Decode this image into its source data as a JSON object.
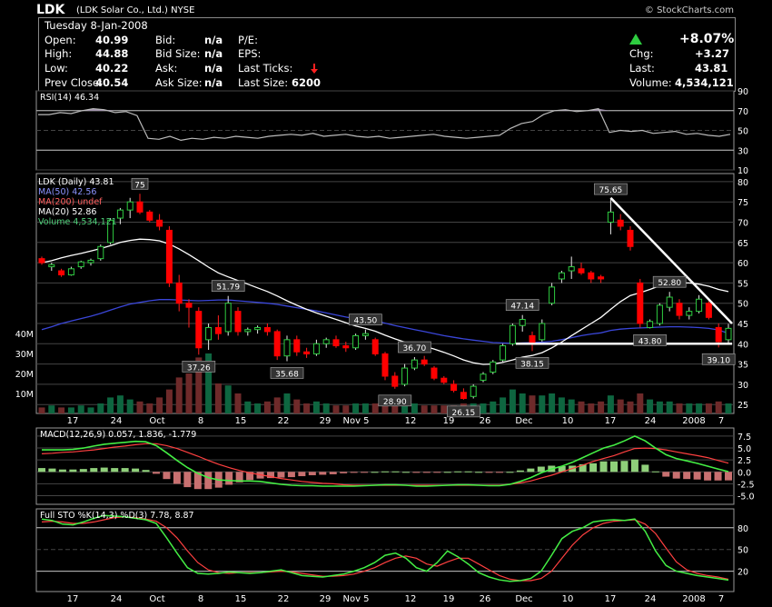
{
  "header": {
    "symbol": "LDK",
    "name": "(LDK Solar Co., Ltd.)",
    "exchange": "NYSE",
    "watermark": "© StockCharts.com",
    "date": "Tuesday  8-Jan-2008",
    "open_label": "Open:",
    "open": "40.99",
    "high_label": "High:",
    "high": "44.88",
    "low_label": "Low:",
    "low": "40.22",
    "prev_label": "Prev Close:",
    "prev": "40.54",
    "bid_label": "Bid:",
    "bid": "n/a",
    "bidsize_label": "Bid Size:",
    "bidsize": "n/a",
    "ask_label": "Ask:",
    "ask": "n/a",
    "asksize_label": "Ask Size:",
    "asksize": "n/a",
    "pe_label": "P/E:",
    "eps_label": "EPS:",
    "lastticks_label": "Last Ticks:",
    "lastsize_label": "Last Size:",
    "lastsize": "6200",
    "pct_change": "+8.07%",
    "chg_label": "Chg:",
    "chg": "+3.27",
    "last_label": "Last:",
    "last": "43.81",
    "volume_label": "Volume:",
    "volume": "4,534,121"
  },
  "colors": {
    "up": "#2ecc40",
    "down": "#ff0000",
    "ma50": "#3a46d8",
    "ma20": "#ffffff",
    "vol_up": "#0e6640",
    "vol_down": "#6e2a2a",
    "grid": "#444"
  },
  "chart_data": [
    {
      "type": "line",
      "title": "RSI(14) 46.34",
      "ylim": [
        10,
        90
      ],
      "y_ticks": [
        "90",
        "70",
        "50",
        "30",
        "10"
      ],
      "series": [
        {
          "name": "RSI(14)",
          "values": [
            66,
            66,
            68,
            67,
            70,
            72,
            71,
            68,
            69,
            65,
            42,
            41,
            44,
            40,
            42,
            41,
            43,
            42,
            44,
            43,
            42,
            44,
            45,
            46,
            45,
            47,
            44,
            45,
            46,
            44,
            43,
            44,
            42,
            43,
            44,
            45,
            46,
            44,
            43,
            42,
            43,
            44,
            45,
            52,
            57,
            59,
            66,
            70,
            71,
            69,
            70,
            72,
            48,
            50,
            49,
            50,
            47,
            48,
            49,
            46,
            47,
            45,
            44,
            46
          ]
        }
      ]
    },
    {
      "type": "candlestick",
      "legend": [
        "LDK (Daily) 43.81",
        "MA(50) 42.56",
        "MA(200) undef",
        "MA(20) 52.86",
        "Volume 4,534,121"
      ],
      "ylim": [
        25,
        80
      ],
      "y_ticks": [
        "80",
        "75",
        "70",
        "65",
        "60",
        "55",
        "50",
        "45",
        "40",
        "35",
        "30",
        "25"
      ],
      "x_ticks": [
        "17",
        "24",
        "Oct",
        "8",
        "15",
        "22",
        "29",
        "Nov 5",
        "12",
        "19",
        "26",
        "Dec",
        "10",
        "17",
        "24",
        "2008",
        "7"
      ],
      "volume_ticks": [
        "40M",
        "30M",
        "20M",
        "10M"
      ],
      "annotations": [
        "75",
        "51.79",
        "37.26",
        "35.68",
        "43.50",
        "36.70",
        "28.90",
        "26.15",
        "47.14",
        "38.15",
        "75.65",
        "52.80",
        "43.80",
        "39.10"
      ],
      "ohlc": [
        [
          61,
          61.5,
          59.5,
          60.0
        ],
        [
          59,
          60,
          58,
          59.5
        ],
        [
          58,
          58.5,
          56.5,
          57
        ],
        [
          57,
          59,
          56.8,
          58.5
        ],
        [
          59,
          60.5,
          58.5,
          60.2
        ],
        [
          60,
          61,
          59.3,
          60.6
        ],
        [
          61,
          64.5,
          60.5,
          64
        ],
        [
          65,
          71,
          64.5,
          70.5
        ],
        [
          71,
          73.5,
          69.5,
          73
        ],
        [
          73,
          76,
          71,
          75
        ],
        [
          75,
          77,
          72,
          72.5
        ],
        [
          72.5,
          73,
          70,
          70.5
        ],
        [
          70.5,
          72,
          68,
          69
        ],
        [
          68,
          69,
          54,
          55
        ],
        [
          55,
          57,
          48,
          50
        ],
        [
          50,
          51,
          44,
          49
        ],
        [
          48,
          49,
          37.3,
          39
        ],
        [
          41,
          45,
          38.5,
          44
        ],
        [
          44,
          47,
          41,
          42.5
        ],
        [
          43,
          51.8,
          42,
          50
        ],
        [
          48,
          49,
          42,
          43
        ],
        [
          43,
          44,
          42,
          43.5
        ],
        [
          43.5,
          44.5,
          42.5,
          44
        ],
        [
          44,
          45,
          42,
          43
        ],
        [
          43,
          43.5,
          36,
          37
        ],
        [
          37,
          42,
          35.7,
          41
        ],
        [
          41,
          42,
          37,
          38
        ],
        [
          38,
          39,
          36.5,
          37.5
        ],
        [
          37.5,
          41,
          37,
          40
        ],
        [
          40,
          41.5,
          39,
          41
        ],
        [
          41,
          42,
          39,
          39.5
        ],
        [
          39.5,
          40.5,
          38,
          39
        ],
        [
          39,
          42.5,
          38.5,
          42
        ],
        [
          42,
          43.5,
          41,
          42.5
        ],
        [
          41,
          41.5,
          37,
          37.5
        ],
        [
          37.5,
          38,
          31,
          32
        ],
        [
          32,
          33,
          28.9,
          29.5
        ],
        [
          30,
          35,
          29.5,
          34
        ],
        [
          34,
          36.7,
          33.5,
          36
        ],
        [
          36,
          37,
          34.5,
          35
        ],
        [
          34,
          34.5,
          31,
          31.5
        ],
        [
          31.5,
          32,
          30,
          30.5
        ],
        [
          30,
          31,
          28,
          28.5
        ],
        [
          28,
          29,
          26.2,
          26.5
        ],
        [
          27,
          30,
          26.5,
          29.5
        ],
        [
          31,
          33,
          30.5,
          32.5
        ],
        [
          33,
          36,
          32.5,
          35.5
        ],
        [
          36,
          40,
          35.5,
          39.5
        ],
        [
          40,
          45,
          39.5,
          44.5
        ],
        [
          44.5,
          47.1,
          43,
          46
        ],
        [
          42,
          43,
          38.2,
          40
        ],
        [
          41,
          46,
          40.5,
          45
        ],
        [
          50,
          55,
          49.5,
          54
        ],
        [
          56,
          58,
          55,
          57.5
        ],
        [
          58,
          61.5,
          56,
          59
        ],
        [
          58.5,
          60,
          57,
          57.5
        ],
        [
          57.5,
          58,
          55,
          56
        ],
        [
          56.5,
          57,
          55,
          56
        ],
        [
          70,
          75.7,
          67,
          72.5
        ],
        [
          70.5,
          72,
          68,
          69
        ],
        [
          68,
          69,
          63,
          64
        ],
        [
          55,
          56,
          44,
          45
        ],
        [
          44,
          46,
          43.8,
          45.5
        ],
        [
          45,
          50,
          44.5,
          49.5
        ],
        [
          49,
          52.8,
          48,
          51.5
        ],
        [
          50,
          51,
          46,
          47
        ],
        [
          47,
          49,
          46,
          48
        ],
        [
          48,
          52,
          47.5,
          51
        ],
        [
          50,
          50.5,
          46,
          46.5
        ],
        [
          44,
          45,
          39.1,
          40.5
        ],
        [
          41,
          44.9,
          40.2,
          43.8
        ]
      ],
      "ma50": [
        43.5,
        44.2,
        45,
        45.6,
        46.2,
        46.8,
        47.5,
        48.3,
        49.1,
        49.8,
        50.2,
        50.6,
        50.9,
        50.9,
        50.8,
        50.7,
        50.6,
        50.7,
        50.8,
        50.8,
        50.6,
        50.4,
        50.2,
        50,
        49.7,
        49.3,
        48.9,
        48.5,
        48.1,
        47.6,
        47.1,
        46.6,
        46.2,
        46,
        45.7,
        45.1,
        44.5,
        44,
        43.5,
        43,
        42.5,
        42,
        41.6,
        41.2,
        40.9,
        40.6,
        40.3,
        40.2,
        40.1,
        40.2,
        40.3,
        40.4,
        40.6,
        41,
        41.5,
        42,
        42.4,
        42.7,
        43.3,
        43.6,
        43.8,
        43.9,
        44,
        44.1,
        44.2,
        44.2,
        44.1,
        44,
        43.8,
        43.4,
        42.56
      ],
      "ma20": [
        60,
        60.5,
        61.2,
        61.8,
        62.3,
        62.9,
        63.5,
        64.2,
        65,
        65.5,
        65.8,
        65.7,
        65.4,
        64.6,
        63.4,
        62,
        60.5,
        58.9,
        57.5,
        56.5,
        55.6,
        54.7,
        53.8,
        52.9,
        51.8,
        50.6,
        49.5,
        48.5,
        47.6,
        46.8,
        46,
        45.2,
        44.4,
        43.8,
        43.1,
        42.1,
        41.2,
        40.4,
        39.8,
        39.4,
        38.7,
        37.9,
        37,
        36,
        35.3,
        34.9,
        35,
        35.4,
        36,
        36.7,
        37.1,
        37.8,
        39,
        40.4,
        42,
        43.5,
        45,
        46.5,
        48.5,
        50.4,
        51.9,
        52.6,
        53.4,
        54.3,
        54.8,
        55,
        55,
        54.7,
        54.2,
        53.4,
        52.86
      ],
      "volume_m": [
        3,
        4,
        3,
        3,
        4,
        3,
        5,
        8,
        9,
        7,
        6,
        5,
        8,
        12,
        18,
        20,
        28,
        30,
        15,
        14,
        10,
        6,
        5,
        6,
        8,
        10,
        7,
        5,
        6,
        5,
        4,
        4,
        5,
        5,
        5,
        7,
        8,
        6,
        5,
        4,
        4,
        4,
        4,
        5,
        5,
        5,
        6,
        8,
        12,
        10,
        9,
        9,
        10,
        8,
        7,
        6,
        5,
        6,
        9,
        7,
        6,
        10,
        7,
        6,
        6,
        5,
        5,
        5,
        5,
        6,
        5
      ]
    },
    {
      "type": "line",
      "title": "MACD(12,26,9) 0.057, 1.836, -1.779",
      "ylim": [
        -5,
        7.5
      ],
      "y_ticks": [
        "7.5",
        "5.0",
        "2.5",
        "0.0",
        "-2.5",
        "-5.0"
      ],
      "series": [
        {
          "name": "MACD",
          "values": [
            4.6,
            4.6,
            4.6,
            4.7,
            5,
            5.4,
            5.8,
            6,
            6.2,
            6.4,
            6.3,
            5.5,
            4,
            2.4,
            0.9,
            -0.3,
            -1.2,
            -1.7,
            -1.8,
            -1.9,
            -1.9,
            -2,
            -2.3,
            -2.6,
            -2.8,
            -2.9,
            -2.9,
            -3,
            -3,
            -3,
            -3,
            -2.9,
            -2.8,
            -2.7,
            -2.7,
            -2.8,
            -3,
            -3,
            -2.9,
            -2.8,
            -2.7,
            -2.7,
            -2.8,
            -2.9,
            -2.9,
            -2.6,
            -2,
            -1.2,
            -0.2,
            0.6,
            1.2,
            2,
            3,
            4,
            5,
            5.6,
            6.5,
            7.5,
            6.5,
            5,
            3.6,
            2.8,
            2.3,
            1.8,
            1.2,
            0.6,
            0.057
          ]
        },
        {
          "name": "Signal",
          "values": [
            3.8,
            3.9,
            4.1,
            4.2,
            4.4,
            4.6,
            4.9,
            5.2,
            5.4,
            5.7,
            5.9,
            5.9,
            5.5,
            4.9,
            4.1,
            3.3,
            2.4,
            1.6,
            0.9,
            0.3,
            -0.2,
            -0.6,
            -1,
            -1.4,
            -1.7,
            -2,
            -2.2,
            -2.4,
            -2.5,
            -2.7,
            -2.8,
            -2.8,
            -2.8,
            -2.8,
            -2.8,
            -2.8,
            -2.8,
            -2.8,
            -2.8,
            -2.8,
            -2.8,
            -2.8,
            -2.8,
            -2.8,
            -2.8,
            -2.6,
            -2.3,
            -1.9,
            -1.3,
            -0.7,
            0,
            0.7,
            1.4,
            2.2,
            2.8,
            3.4,
            4.2,
            4.9,
            5,
            4.9,
            4.6,
            4.2,
            3.8,
            3.4,
            3,
            2.4,
            1.836
          ]
        },
        {
          "name": "Histogram",
          "values": [
            0.8,
            0.7,
            0.5,
            0.5,
            0.6,
            0.8,
            0.9,
            0.8,
            0.8,
            0.7,
            0.4,
            -0.4,
            -1.5,
            -2.5,
            -3.2,
            -3.6,
            -3.6,
            -3.3,
            -2.7,
            -2.2,
            -1.7,
            -1.4,
            -1.3,
            -1.2,
            -1.1,
            -0.9,
            -0.7,
            -0.6,
            -0.5,
            -0.3,
            -0.2,
            -0.1,
            0,
            0.1,
            0.1,
            0,
            -0.2,
            -0.2,
            -0.1,
            0,
            0.1,
            0.1,
            0,
            -0.1,
            -0.1,
            0,
            0.3,
            0.7,
            1.1,
            1.3,
            1.2,
            1.3,
            1.6,
            1.8,
            2.2,
            2.2,
            2.3,
            2.6,
            1.5,
            0.1,
            -1,
            -1.4,
            -1.5,
            -1.6,
            -1.8,
            -1.8,
            -1.779
          ]
        }
      ]
    },
    {
      "type": "line",
      "title": "Full STO %K(14,3) %D(3) 7.78, 8.87",
      "ylim": [
        0,
        100
      ],
      "y_ticks": [
        "80",
        "50",
        "20"
      ],
      "series": [
        {
          "name": "%K",
          "values": [
            92,
            90,
            85,
            84,
            88,
            93,
            97,
            96,
            95,
            93,
            91,
            86,
            66,
            45,
            25,
            17,
            16,
            17,
            19,
            18,
            17,
            18,
            20,
            22,
            18,
            14,
            13,
            12,
            14,
            16,
            20,
            25,
            32,
            42,
            45,
            38,
            25,
            20,
            32,
            48,
            40,
            30,
            18,
            12,
            8,
            6,
            7,
            10,
            20,
            42,
            65,
            75,
            80,
            88,
            90,
            91,
            90,
            92,
            75,
            48,
            28,
            20,
            17,
            14,
            12,
            10,
            7.78
          ]
        },
        {
          "name": "%D",
          "values": [
            88,
            89,
            88,
            86,
            86,
            88,
            91,
            94,
            95,
            94,
            92,
            89,
            80,
            66,
            48,
            32,
            22,
            18,
            17,
            18,
            18,
            18,
            19,
            20,
            19,
            17,
            15,
            13,
            13,
            14,
            16,
            20,
            25,
            32,
            38,
            41,
            38,
            30,
            27,
            33,
            38,
            38,
            30,
            22,
            14,
            9,
            7,
            7,
            10,
            20,
            38,
            56,
            70,
            80,
            86,
            89,
            90,
            91,
            85,
            72,
            52,
            33,
            22,
            17,
            14,
            12,
            8.87
          ]
        }
      ]
    }
  ]
}
